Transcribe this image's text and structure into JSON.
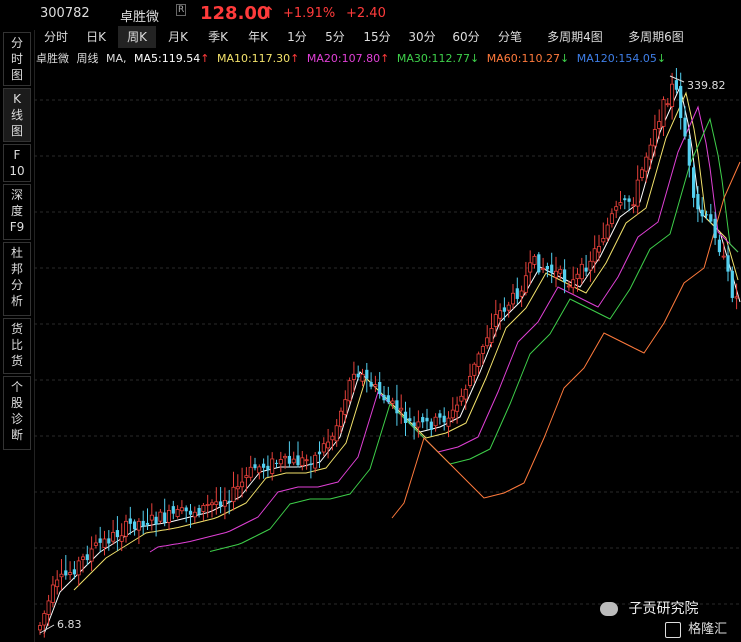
{
  "header": {
    "code": "300782",
    "name": "卓胜微",
    "badge": "R",
    "price": "128.00",
    "arrow": "↑",
    "change_pct": "+1.91%",
    "change_abs": "+2.40"
  },
  "sidebar": {
    "items": [
      {
        "label": "分\n时\n图"
      },
      {
        "label": "K\n线\n图"
      },
      {
        "label": "F\n10"
      },
      {
        "label": "深\n度\nF9"
      },
      {
        "label": "杜\n邦\n分\n析"
      },
      {
        "label": "货\n比\n货"
      },
      {
        "label": "个\n股\n诊\n断"
      }
    ]
  },
  "tabs": [
    {
      "label": "分时"
    },
    {
      "label": "日K"
    },
    {
      "label": "周K"
    },
    {
      "label": "月K"
    },
    {
      "label": "季K"
    },
    {
      "label": "年K"
    },
    {
      "label": "1分"
    },
    {
      "label": "5分"
    },
    {
      "label": "15分"
    },
    {
      "label": "30分"
    },
    {
      "label": "60分"
    },
    {
      "label": "分笔"
    },
    {
      "label": "多周期4图"
    },
    {
      "label": "多周期6图"
    }
  ],
  "active_tab": "周K",
  "ma_bar": {
    "stock": "卓胜微",
    "period": "周线",
    "ma": "MA",
    "ma5": "MA5:119.54",
    "ma10": "MA10:117.30",
    "ma20": "MA20:107.80",
    "ma30": "MA30:112.77",
    "ma60": "MA60:110.27",
    "ma120": "MA120:154.05",
    "ma5_arrow": "↑",
    "ma10_arrow": "↑",
    "ma20_arrow": "↑",
    "ma30_arrow": "↓",
    "ma60_arrow": "↓",
    "ma120_arrow": "↓"
  },
  "colors": {
    "up": "#e8413b",
    "down": "#54d0f0",
    "ma5": "#ffffff",
    "ma10": "#f3e26b",
    "ma20": "#e040d6",
    "ma30": "#3ecf4a",
    "ma60": "#ff7a3c",
    "ma120": "#3f7fe8",
    "price_up": "#ff3b3b"
  },
  "chart_labels": {
    "high_label": "339.82",
    "low_label": "6.83"
  },
  "watermark": {
    "text": "子贡研究院",
    "logo": "格隆汇"
  }
}
